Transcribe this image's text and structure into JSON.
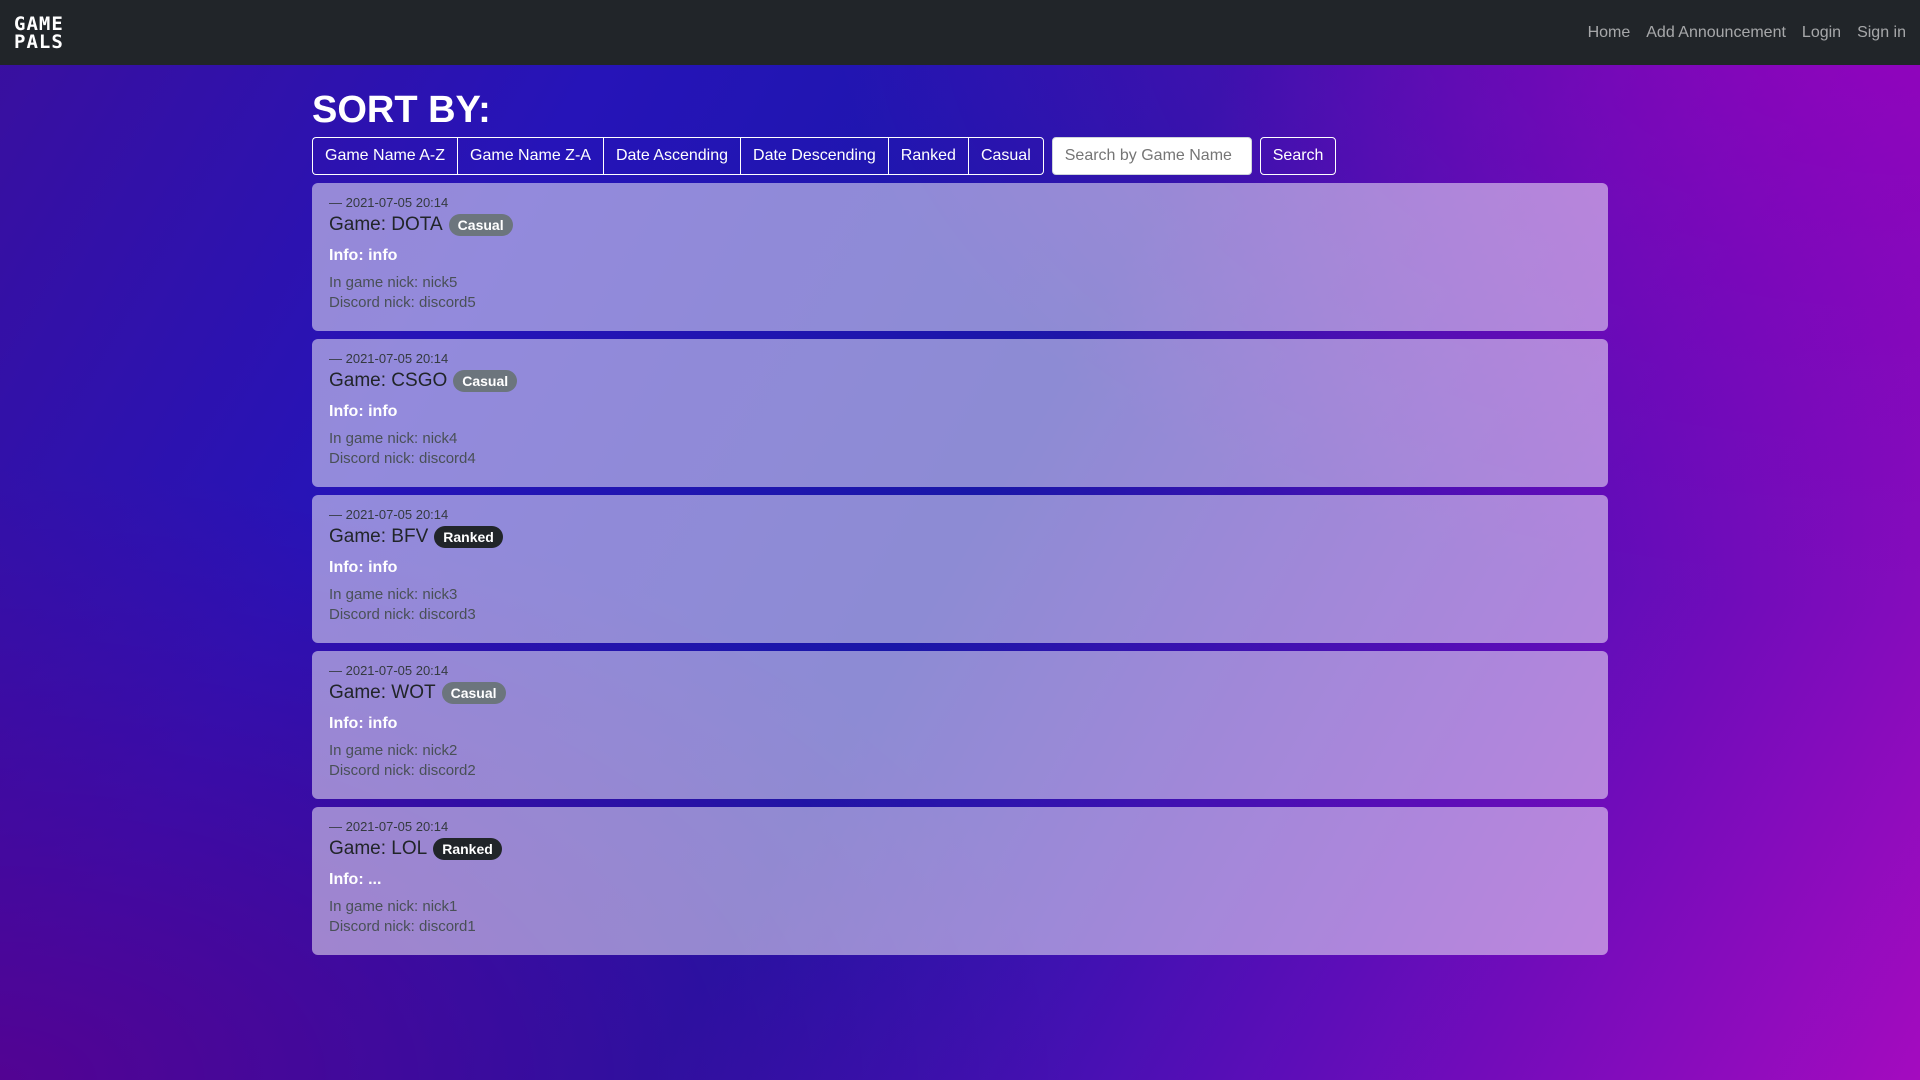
{
  "nav": {
    "logo_line1": "GAME",
    "logo_line2": "PALS",
    "links": [
      "Home",
      "Add Announcement",
      "Login",
      "Sign in"
    ]
  },
  "sort": {
    "title": "SORT BY:",
    "buttons": [
      "Game Name A-Z",
      "Game Name Z-A",
      "Date Ascending",
      "Date Descending",
      "Ranked",
      "Casual"
    ],
    "search_placeholder": "Search by Game Name",
    "search_button": "Search"
  },
  "announcements": [
    {
      "date": "— 2021-07-05 20:14",
      "game": "Game: DOTA",
      "type": "Casual",
      "info": "Info: info",
      "nick": "In game nick: nick5",
      "discord": "Discord nick: discord5"
    },
    {
      "date": "— 2021-07-05 20:14",
      "game": "Game: CSGO",
      "type": "Casual",
      "info": "Info: info",
      "nick": "In game nick: nick4",
      "discord": "Discord nick: discord4"
    },
    {
      "date": "— 2021-07-05 20:14",
      "game": "Game: BFV",
      "type": "Ranked",
      "info": "Info: info",
      "nick": "In game nick: nick3",
      "discord": "Discord nick: discord3"
    },
    {
      "date": "— 2021-07-05 20:14",
      "game": "Game: WOT",
      "type": "Casual",
      "info": "Info: info",
      "nick": "In game nick: nick2",
      "discord": "Discord nick: discord2"
    },
    {
      "date": "— 2021-07-05 20:14",
      "game": "Game: LOL",
      "type": "Ranked",
      "info": "Info: ...",
      "nick": "In game nick: nick1",
      "discord": "Discord nick: discord1"
    }
  ]
}
